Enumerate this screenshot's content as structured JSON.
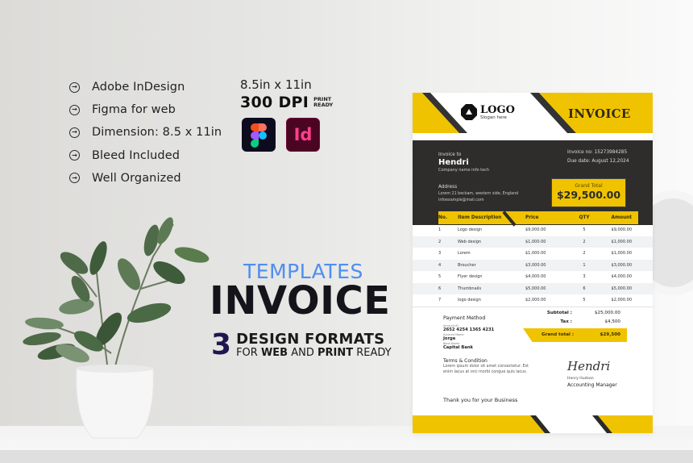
{
  "features": [
    {
      "icon": "arrow-circle-right-icon",
      "label": "Adobe InDesign"
    },
    {
      "icon": "arrow-circle-right-icon",
      "label": "Figma for web"
    },
    {
      "icon": "arrow-circle-right-icon",
      "label": "Dimension: 8.5 x 11in"
    },
    {
      "icon": "arrow-circle-right-icon",
      "label": "Bleed Included"
    },
    {
      "icon": "arrow-circle-right-icon",
      "label": "Well Organized"
    }
  ],
  "specs": {
    "dimension": "8.5in x 11in",
    "dpi": "300 DPI",
    "print_ready_line1": "PRINT",
    "print_ready_line2": "READY",
    "apps": [
      {
        "name": "figma-icon",
        "label": ""
      },
      {
        "name": "indesign-icon",
        "label": "Id"
      }
    ]
  },
  "headline": {
    "templates": "TEMPLATES",
    "invoice": "INVOICE",
    "count": "3",
    "formats": "DESIGN FORMATS",
    "sub_for": "FOR ",
    "sub_web": "WEB",
    "sub_and": " AND ",
    "sub_print": "PRINT",
    "sub_ready": " READY"
  },
  "colors": {
    "accent_yellow": "#f0c300",
    "dark": "#2e2d2b",
    "templates_blue": "#4f8ef0",
    "count_navy": "#1f1650"
  },
  "invoice": {
    "logo": "LOGO",
    "slogan": "Slogan here",
    "title": "INVOICE",
    "invoice_to_label": "Invoice to",
    "client_name": "Hendri",
    "company": "Company name  info tech",
    "invoice_no": "Invoice no: 15273984285",
    "due_date": "Due date: August 12,2024",
    "address_label": "Address",
    "address_line": "Lorem 21 beckam, western side, England",
    "email": "infoexample@mail.com",
    "grand_total_label": "Grand Total",
    "grand_total_value": "$29,500.00",
    "table": {
      "headers": [
        "No.",
        "Item Description",
        "Price",
        "QTY",
        "Amount"
      ],
      "rows": [
        [
          "1",
          "Logo design",
          "$9,000.00",
          "5",
          "$9,000.00"
        ],
        [
          "2",
          "Web design",
          "$1,000.00",
          "2",
          "$1,000.00"
        ],
        [
          "3",
          "Lorem",
          "$1,000.00",
          "2",
          "$1,000.00"
        ],
        [
          "4",
          "Broucher",
          "$3,000.00",
          "1",
          "$3,000.00"
        ],
        [
          "5",
          "Flyer design",
          "$4,000.00",
          "3",
          "$4,000.00"
        ],
        [
          "6",
          "Thumbnails",
          "$5,000.00",
          "6",
          "$5,000.00"
        ],
        [
          "7",
          "logo design",
          "$2,000.00",
          "5",
          "$2,000.00"
        ]
      ]
    },
    "payment_method_label": "Payment Method",
    "account_id_label": "Account ID",
    "account_id": "2652 4254 1365 4231",
    "account_name_label": "Account Name",
    "account_name": "Jorge",
    "bank_name_label": "Bank Name",
    "bank_name": "Capital Bank",
    "subtotal_label": "Subtotal :",
    "subtotal_value": "$25,000.00",
    "tax_label": "Tax :",
    "tax_value": "$4,500",
    "grand_total2_label": "Grand total :",
    "grand_total2_value": "$29,500",
    "terms_label": "Terms & Condition",
    "terms_text": "Lorem ipsum dolor sit amet consectetur. Est enim lacus at orci morbi congue quis lacus.",
    "signature": "Hendri",
    "signer_name": "Henry Hudson",
    "signer_role": "Accounting Manager",
    "thanks": "Thank you for your Business"
  }
}
